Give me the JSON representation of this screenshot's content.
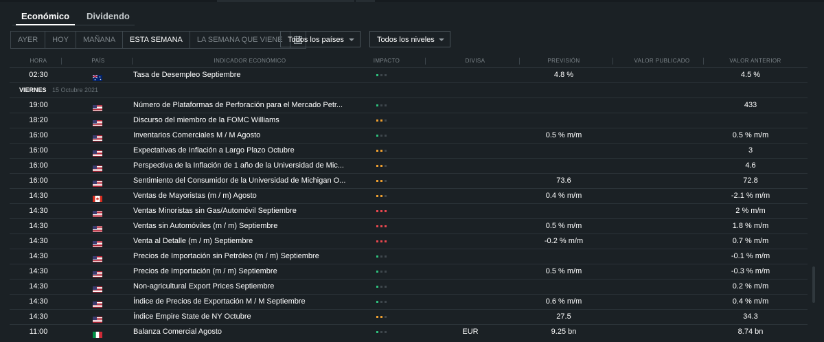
{
  "tabs": [
    {
      "label": "Económico",
      "active": true
    },
    {
      "label": "Dividendo",
      "active": false
    }
  ],
  "date_filters": [
    "AYER",
    "HOY",
    "MAÑANA",
    "ESTA SEMANA",
    "LA SEMANA QUE VIENE"
  ],
  "active_date_filter": "ESTA SEMANA",
  "calendar_icon": "calendar-icon",
  "country_select": {
    "value": "Todos los países"
  },
  "level_select": {
    "value": "Todos los niveles"
  },
  "columns": {
    "time": "HORA",
    "country": "PAÍS",
    "indicator": "INDICADOR ECONÓMICO",
    "impact": "IMPACTO",
    "currency": "DIVISA",
    "forecast": "PREVISIÓN",
    "published": "VALOR PUBLICADO",
    "previous": "VALOR ANTERIOR"
  },
  "impact_colors": {
    "low": "#2ec27e",
    "medium": "#f0a030",
    "high": "#e9474f",
    "off": "#3f474d"
  },
  "first_row": {
    "time": "02:30",
    "flag": "australia",
    "indicator": "Tasa de Desempleo Septiembre",
    "impact": "low",
    "currency": "",
    "forecast": "4.8 %",
    "published": "",
    "previous": "4.5 %"
  },
  "day_header": {
    "day": "VIERNES",
    "date": "15 Octubre 2021"
  },
  "events": [
    {
      "time": "19:00",
      "flag": "us",
      "indicator": "Número de Plataformas de Perforación para el Mercado Petr...",
      "impact": "low",
      "currency": "",
      "forecast": "",
      "published": "",
      "previous": "433"
    },
    {
      "time": "18:20",
      "flag": "us",
      "indicator": "Discurso del miembro de la FOMC Williams",
      "impact": "medium",
      "currency": "",
      "forecast": "",
      "published": "",
      "previous": ""
    },
    {
      "time": "16:00",
      "flag": "us",
      "indicator": "Inventarios Comerciales M / M Agosto",
      "impact": "low",
      "currency": "",
      "forecast": "0.5 % m/m",
      "published": "",
      "previous": "0.5 % m/m"
    },
    {
      "time": "16:00",
      "flag": "us",
      "indicator": "Expectativas de Inflación a Largo Plazo Octubre",
      "impact": "medium",
      "currency": "",
      "forecast": "",
      "published": "",
      "previous": "3"
    },
    {
      "time": "16:00",
      "flag": "us",
      "indicator": "Perspectiva de la Inflación de 1 año de la Universidad de Mic...",
      "impact": "medium",
      "currency": "",
      "forecast": "",
      "published": "",
      "previous": "4.6"
    },
    {
      "time": "16:00",
      "flag": "us",
      "indicator": "Sentimiento del Consumidor de la Universidad de Michigan O...",
      "impact": "medium",
      "currency": "",
      "forecast": "73.6",
      "published": "",
      "previous": "72.8"
    },
    {
      "time": "14:30",
      "flag": "canada",
      "indicator": "Ventas de Mayoristas (m / m) Agosto",
      "impact": "medium",
      "currency": "",
      "forecast": "0.4 % m/m",
      "published": "",
      "previous": "-2.1 % m/m"
    },
    {
      "time": "14:30",
      "flag": "us",
      "indicator": "Ventas Minoristas sin Gas/Automóvil Septiembre",
      "impact": "high",
      "currency": "",
      "forecast": "",
      "published": "",
      "previous": "2 % m/m"
    },
    {
      "time": "14:30",
      "flag": "us",
      "indicator": "Ventas sin Automóviles (m / m) Septiembre",
      "impact": "high",
      "currency": "",
      "forecast": "0.5 % m/m",
      "published": "",
      "previous": "1.8 % m/m"
    },
    {
      "time": "14:30",
      "flag": "us",
      "indicator": "Venta al Detalle (m / m) Septiembre",
      "impact": "high",
      "currency": "",
      "forecast": "-0.2 % m/m",
      "published": "",
      "previous": "0.7 % m/m"
    },
    {
      "time": "14:30",
      "flag": "us",
      "indicator": "Precios de Importación sin Petróleo (m / m) Septiembre",
      "impact": "low",
      "currency": "",
      "forecast": "",
      "published": "",
      "previous": "-0.1 % m/m"
    },
    {
      "time": "14:30",
      "flag": "us",
      "indicator": "Precios de Importación (m / m) Septiembre",
      "impact": "low",
      "currency": "",
      "forecast": "0.5 % m/m",
      "published": "",
      "previous": "-0.3 % m/m"
    },
    {
      "time": "14:30",
      "flag": "us",
      "indicator": "Non-agricultural Export Prices Septiembre",
      "impact": "low",
      "currency": "",
      "forecast": "",
      "published": "",
      "previous": "0.2 % m/m"
    },
    {
      "time": "14:30",
      "flag": "us",
      "indicator": "Índice de Precios de Exportación M / M Septiembre",
      "impact": "low",
      "currency": "",
      "forecast": "0.6 % m/m",
      "published": "",
      "previous": "0.4 % m/m"
    },
    {
      "time": "14:30",
      "flag": "us",
      "indicator": "Índice Empire State de NY Octubre",
      "impact": "medium",
      "currency": "",
      "forecast": "27.5",
      "published": "",
      "previous": "34.3"
    },
    {
      "time": "11:00",
      "flag": "italy",
      "indicator": "Balanza Comercial Agosto",
      "impact": "low",
      "currency": "EUR",
      "forecast": "9.25 bn",
      "published": "",
      "previous": "8.74 bn"
    }
  ]
}
